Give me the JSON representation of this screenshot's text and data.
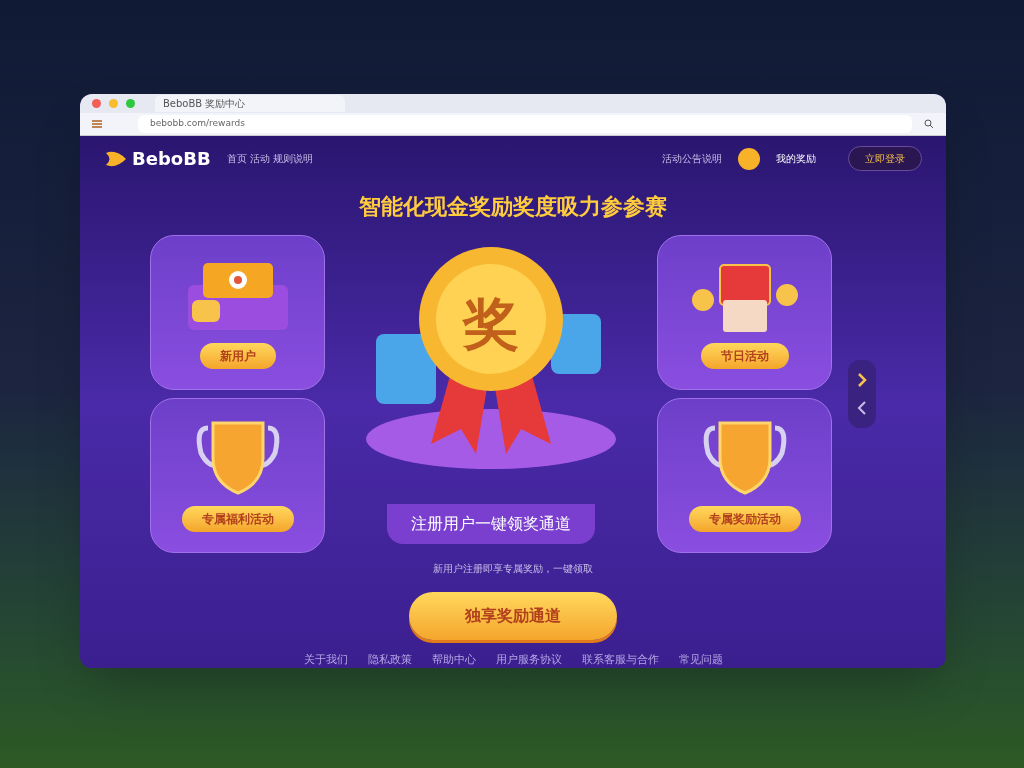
{
  "browser": {
    "tab_title": "BeboBB 奖励中心",
    "url": "bebobb.com/rewards"
  },
  "header": {
    "logo": "BeboBB",
    "nav": "首页 活动 规则说明",
    "notice": "活动公告说明",
    "account": "我的奖励",
    "login": "立即登录"
  },
  "title": "智能化现金奖励奖度吸力参参赛",
  "left_cards": [
    {
      "kind": "gift",
      "label": "新用户"
    },
    {
      "kind": "trophy",
      "label": "专属福利活动"
    }
  ],
  "right_cards": [
    {
      "kind": "chest",
      "label": "节日活动"
    },
    {
      "kind": "trophy",
      "label": "专属奖励活动"
    }
  ],
  "medal": "奖",
  "stage_label": "注册用户一键领奖通道",
  "description": "新用户注册即享专属奖励，一键领取",
  "cta": "独享奖励通道",
  "footer": [
    "关于我们",
    "隐私政策",
    "帮助中心",
    "用户服务协议",
    "联系客服与合作",
    "常见问题"
  ]
}
